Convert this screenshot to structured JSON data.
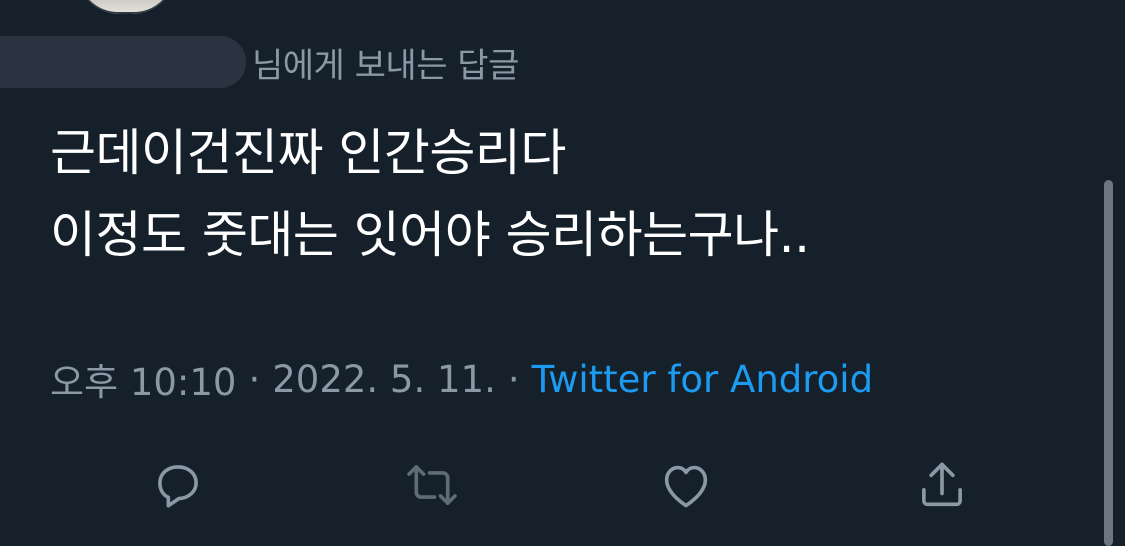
{
  "reply_context": {
    "text": "님에게 보내는 답글"
  },
  "tweet": {
    "lines": [
      "근데이건진짜 인간승리다",
      "이정도 줏대는 잇어야 승리하는구나.."
    ]
  },
  "meta": {
    "time": "오후 10:10",
    "separator": "·",
    "date": "2022. 5. 11.",
    "source": "Twitter for Android"
  },
  "actions": {
    "reply_icon": "comment-icon",
    "retweet_icon": "retweet-icon",
    "like_icon": "heart-icon",
    "share_icon": "share-icon"
  },
  "colors": {
    "background": "#15202b",
    "secondary_text": "#8b98a5",
    "link": "#1d9bf0"
  }
}
